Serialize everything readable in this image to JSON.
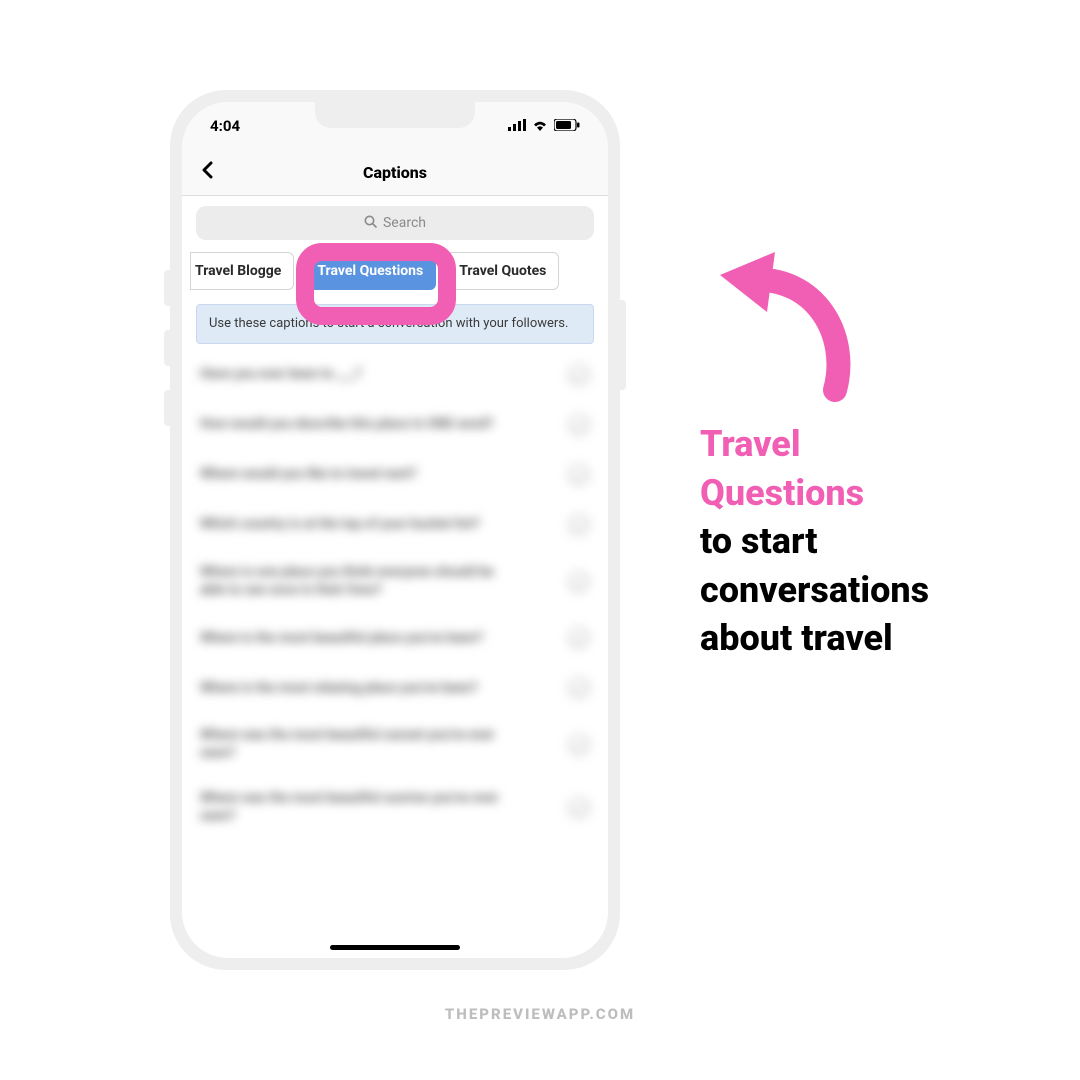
{
  "status": {
    "time": "4:04"
  },
  "nav": {
    "title": "Captions"
  },
  "search": {
    "placeholder": "Search"
  },
  "chips": {
    "blogger": "Travel Blogge",
    "questions": "Travel Questions",
    "quotes": "Travel Quotes"
  },
  "info_banner": "Use these captions to start a conversation with your followers.",
  "captions": [
    "Have you ever been to ___?",
    "How would you describe this place in ONE word?",
    "Where would you like to travel next?",
    "Which country is at the top of your bucket list?",
    "Where is one place you think everyone should be able to see once in their lives?",
    "Where is the most beautiful place you've been?",
    "Where is the most relaxing place you've been?",
    "Where was the most beautiful sunset you've ever seen?",
    "Where was the most beautiful sunrise you've ever seen?"
  ],
  "annotation": {
    "pink1": "Travel",
    "pink2": "Questions",
    "black1": "to start",
    "black2": "conversations",
    "black3": "about travel"
  },
  "footer": "THEPREVIEWAPP.COM",
  "colors": {
    "accent_pink": "#f15fb4",
    "chip_active": "#5a93e0"
  }
}
